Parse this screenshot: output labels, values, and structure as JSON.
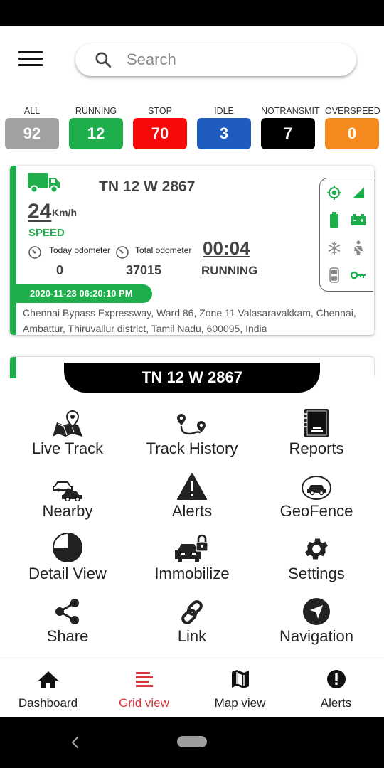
{
  "search": {
    "placeholder": "Search"
  },
  "filters": [
    {
      "label": "ALL",
      "count": "92",
      "color": "#a1a1a1"
    },
    {
      "label": "RUNNING",
      "count": "12",
      "color": "#1fae4c"
    },
    {
      "label": "STOP",
      "count": "70",
      "color": "#f60909"
    },
    {
      "label": "IDLE",
      "count": "3",
      "color": "#1e5cbf"
    },
    {
      "label": "NOTRANSMIT",
      "count": "7",
      "color": "#000000"
    },
    {
      "label": "OVERSPEED",
      "count": "0",
      "color": "#f58a1f"
    }
  ],
  "vehicle": {
    "plate": "TN 12 W 2867",
    "speed": "24",
    "speed_unit": "Km/h",
    "speed_label": "SPEED",
    "today_odometer_label": "Today odometer",
    "today_odometer": "0",
    "total_odometer_label": "Total odometer",
    "total_odometer": "37015",
    "duration": "00:04",
    "status": "RUNNING",
    "datetime": "2020-11-23 06:20:10 PM",
    "address": "Chennai Bypass Expressway, Ward 86, Zone 11 Valasaravakkam, Chennai, Ambattur, Thiruvallur district, Tamil Nadu, 600095, India",
    "accent_color": "#1fae4c",
    "status_icons": [
      "gps-icon",
      "signal-icon",
      "battery-icon",
      "car-battery-icon",
      "ac-icon",
      "seatbelt-icon",
      "door-icon",
      "ignition-key-icon"
    ]
  },
  "sheet": {
    "title": "TN 12 W 2867",
    "actions": [
      {
        "label": "Live Track",
        "icon": "map-pin-icon"
      },
      {
        "label": "Track History",
        "icon": "route-icon"
      },
      {
        "label": "Reports",
        "icon": "report-book-icon"
      },
      {
        "label": "Nearby",
        "icon": "cars-icon"
      },
      {
        "label": "Alerts",
        "icon": "warning-icon"
      },
      {
        "label": "GeoFence",
        "icon": "geofence-icon"
      },
      {
        "label": "Detail View",
        "icon": "pie-chart-icon"
      },
      {
        "label": "Immobilize",
        "icon": "car-lock-icon"
      },
      {
        "label": "Settings",
        "icon": "gear-icon"
      },
      {
        "label": "Share",
        "icon": "share-icon"
      },
      {
        "label": "Link",
        "icon": "link-icon"
      },
      {
        "label": "Navigation",
        "icon": "navigation-icon"
      }
    ]
  },
  "bottom_nav": [
    {
      "label": "Dashboard",
      "icon": "home-icon",
      "active": false
    },
    {
      "label": "Grid view",
      "icon": "grid-list-icon",
      "active": true
    },
    {
      "label": "Map view",
      "icon": "map-icon",
      "active": false
    },
    {
      "label": "Alerts",
      "icon": "alert-circle-icon",
      "active": false
    }
  ],
  "active_color": "#d9363e"
}
